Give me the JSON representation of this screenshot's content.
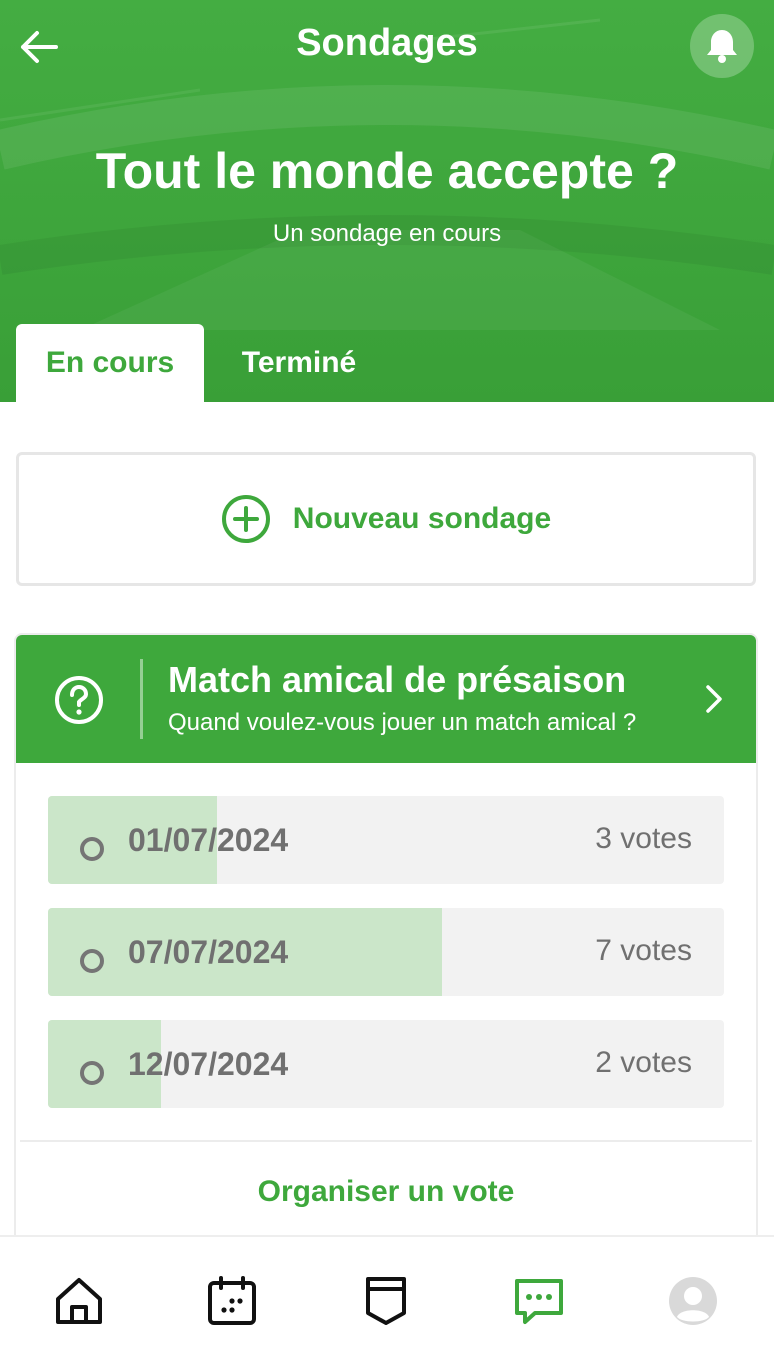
{
  "header": {
    "title": "Sondages",
    "back_icon": "arrow-left-icon",
    "notification_icon": "bell-icon"
  },
  "hero": {
    "title": "Tout le monde accepte ?",
    "subtitle": "Un sondage en cours"
  },
  "tabs": [
    {
      "label": "En cours",
      "active": true
    },
    {
      "label": "Terminé",
      "active": false
    }
  ],
  "new_poll": {
    "label": "Nouveau sondage",
    "icon": "plus-circle-icon"
  },
  "poll": {
    "icon": "question-circle-icon",
    "title": "Match amical de présaison",
    "question": "Quand voulez-vous jouer un match amical ?",
    "options": [
      {
        "date": "01/07/2024",
        "votes_label": "3 votes",
        "votes": 3
      },
      {
        "date": "07/07/2024",
        "votes_label": "7 votes",
        "votes": 7
      },
      {
        "date": "12/07/2024",
        "votes_label": "2 votes",
        "votes": 2
      }
    ],
    "action": "Organiser un vote"
  },
  "bottom_nav": [
    {
      "name": "home",
      "icon": "home-icon",
      "active": false
    },
    {
      "name": "calendar",
      "icon": "calendar-icon",
      "active": false
    },
    {
      "name": "team",
      "icon": "shield-icon",
      "active": false
    },
    {
      "name": "messages",
      "icon": "chat-icon",
      "active": true
    },
    {
      "name": "profile",
      "icon": "avatar-icon",
      "active": false
    }
  ],
  "colors": {
    "primary": "#3ea83c",
    "option_fill": "#cbe6c9",
    "option_bg": "#f2f2f2",
    "muted_text": "#707070"
  }
}
